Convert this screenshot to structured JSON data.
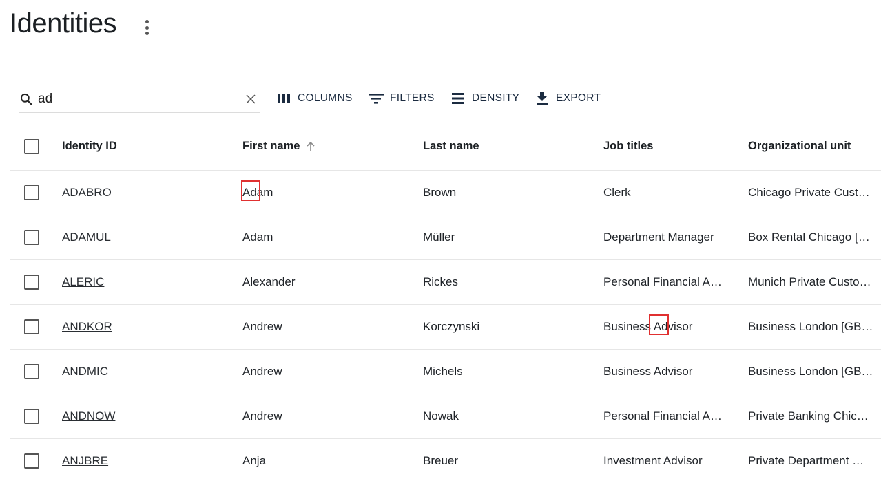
{
  "page": {
    "title": "Identities"
  },
  "search": {
    "value": "ad",
    "placeholder": ""
  },
  "toolbar": {
    "columns_label": "COLUMNS",
    "filters_label": "FILTERS",
    "density_label": "DENSITY",
    "export_label": "EXPORT"
  },
  "table": {
    "headers": {
      "identity_id": "Identity ID",
      "first_name": "First name",
      "last_name": "Last name",
      "job_titles": "Job titles",
      "org_unit": "Organizational unit"
    },
    "sort": {
      "column": "First name",
      "direction": "ascending"
    },
    "rows": [
      {
        "id": "ADABRO",
        "first": "Adam",
        "last": "Brown",
        "job": "Clerk",
        "org": "Chicago Private Cust…"
      },
      {
        "id": "ADAMUL",
        "first": "Adam",
        "last": "Müller",
        "job": "Department Manager",
        "org": "Box Rental Chicago […"
      },
      {
        "id": "ALERIC",
        "first": "Alexander",
        "last": "Rickes",
        "job": "Personal Financial A…",
        "org": "Munich Private Custo…"
      },
      {
        "id": "ANDKOR",
        "first": "Andrew",
        "last": "Korczynski",
        "job": "Business Advisor",
        "org": "Business London [GB…"
      },
      {
        "id": "ANDMIC",
        "first": "Andrew",
        "last": "Michels",
        "job": "Business Advisor",
        "org": "Business London [GB…"
      },
      {
        "id": "ANDNOW",
        "first": "Andrew",
        "last": "Nowak",
        "job": "Personal Financial A…",
        "org": "Private Banking Chic…"
      },
      {
        "id": "ANJBRE",
        "first": "Anja",
        "last": "Breuer",
        "job": "Investment Advisor",
        "org": "Private Department …"
      }
    ]
  },
  "icons": {
    "search": "search-icon",
    "clear": "close-icon",
    "columns": "columns-icon",
    "filters": "filter-icon",
    "density": "density-icon",
    "export": "download-icon",
    "sort": "arrow-up-icon",
    "more": "more-vertical-icon"
  },
  "colors": {
    "highlight": "#e03030",
    "text": "#1b1f23"
  }
}
